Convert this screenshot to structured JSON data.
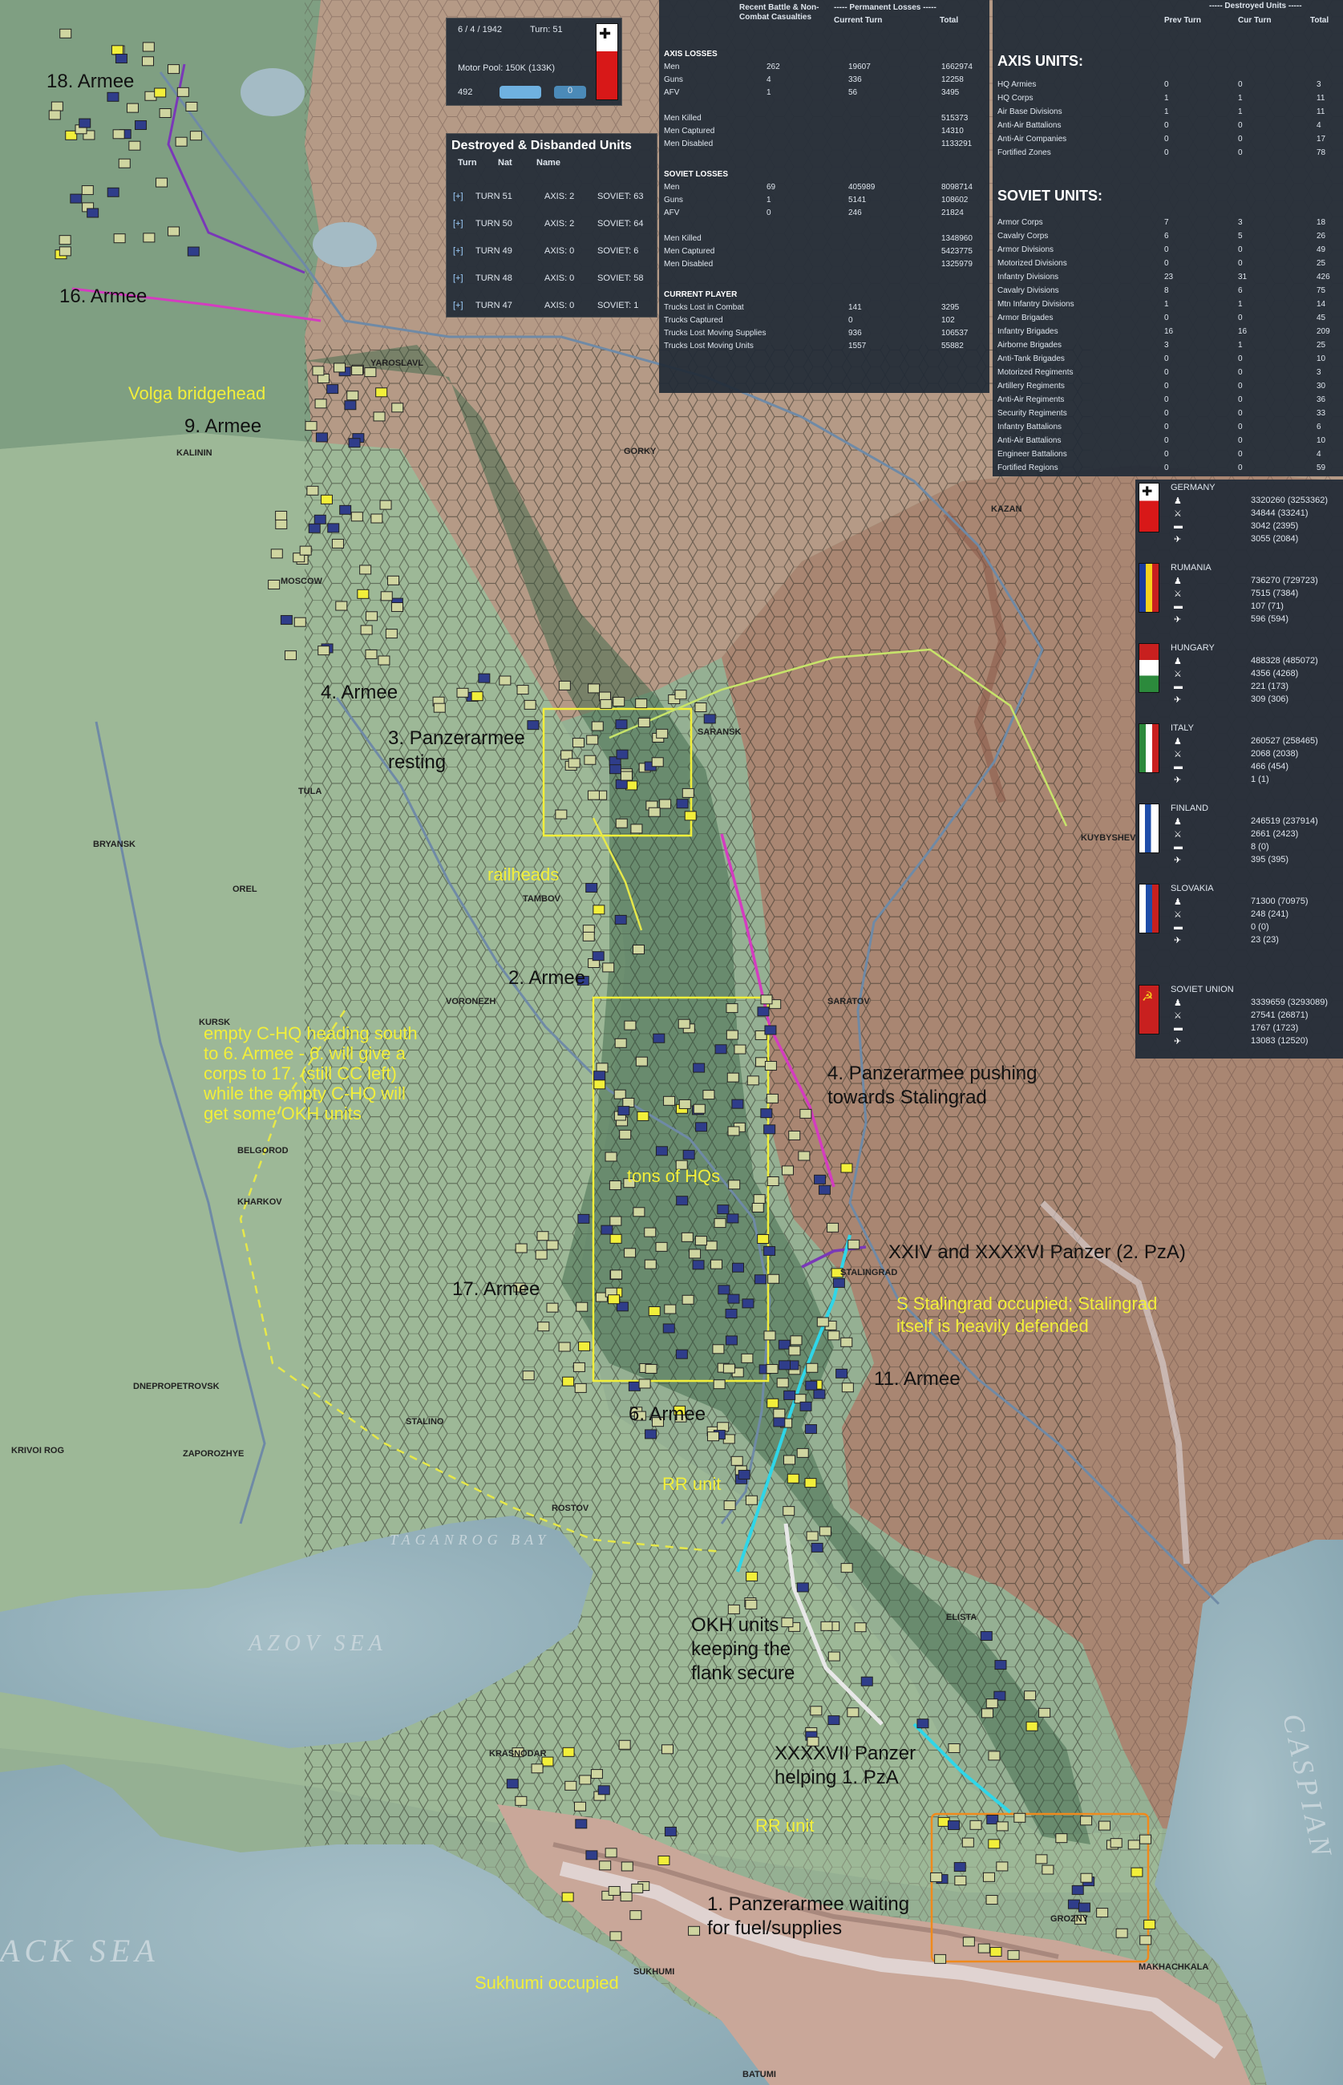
{
  "colors": {
    "axis_unit": "#cfd5a0",
    "soviet_unit": "#2f3d8a",
    "hq_yellow": "#f2ef3a",
    "arrow_magenta": "#d43cc0",
    "arrow_cyan": "#2fd6e8",
    "arrow_white": "#e8e8e8",
    "arrow_purple": "#7a38b8",
    "orange_box": "#f08a1c"
  },
  "turn_box": {
    "date": "6 / 4 / 1942",
    "turn": "Turn: 51",
    "motor_pool": "Motor Pool:  150K (133K)",
    "value_a": "492",
    "value_b": "0"
  },
  "destroyed_panel": {
    "title": "Destroyed & Disbanded Units",
    "headers": [
      "Turn",
      "Nat",
      "Name"
    ],
    "rows": [
      {
        "expand": "[+]",
        "turn": "TURN 51",
        "axis": "AXIS: 2",
        "soviet": "SOVIET: 63"
      },
      {
        "expand": "[+]",
        "turn": "TURN 50",
        "axis": "AXIS: 2",
        "soviet": "SOVIET: 64"
      },
      {
        "expand": "[+]",
        "turn": "TURN 49",
        "axis": "AXIS: 0",
        "soviet": "SOVIET: 6"
      },
      {
        "expand": "[+]",
        "turn": "TURN 48",
        "axis": "AXIS: 0",
        "soviet": "SOVIET: 58"
      },
      {
        "expand": "[+]",
        "turn": "TURN 47",
        "axis": "AXIS: 0",
        "soviet": "SOVIET: 1"
      }
    ]
  },
  "losses_panel": {
    "header_left": "Recent Battle & Non-Combat Casualties",
    "header_right": "----- Permanent Losses -----",
    "col_current": "Current Turn",
    "col_total": "Total",
    "sections": [
      {
        "title": "AXIS LOSSES",
        "rows": [
          [
            "Men",
            "262",
            "19607",
            "1662974"
          ],
          [
            "Guns",
            "4",
            "336",
            "12258"
          ],
          [
            "AFV",
            "1",
            "56",
            "3495"
          ],
          [
            "",
            "",
            "",
            ""
          ],
          [
            "Men Killed",
            "",
            "",
            "515373"
          ],
          [
            "Men Captured",
            "",
            "",
            "14310"
          ],
          [
            "Men Disabled",
            "",
            "",
            "1133291"
          ]
        ]
      },
      {
        "title": "SOVIET LOSSES",
        "rows": [
          [
            "Men",
            "69",
            "405989",
            "8098714"
          ],
          [
            "Guns",
            "1",
            "5141",
            "108602"
          ],
          [
            "AFV",
            "0",
            "246",
            "21824"
          ],
          [
            "",
            "",
            "",
            ""
          ],
          [
            "Men Killed",
            "",
            "",
            "1348960"
          ],
          [
            "Men Captured",
            "",
            "",
            "5423775"
          ],
          [
            "Men Disabled",
            "",
            "",
            "1325979"
          ]
        ]
      },
      {
        "title": "CURRENT PLAYER",
        "rows": [
          [
            "Trucks Lost in Combat",
            "",
            "141",
            "3295"
          ],
          [
            "Trucks Captured",
            "",
            "0",
            "102"
          ],
          [
            "Trucks Lost Moving Supplies",
            "",
            "936",
            "106537"
          ],
          [
            "Trucks Lost Moving Units",
            "",
            "1557",
            "55882"
          ]
        ]
      }
    ]
  },
  "units_panel": {
    "header": "----- Destroyed Units -----",
    "col_prev": "Prev Turn",
    "col_cur": "Cur Turn",
    "col_total": "Total",
    "axis_title": "AXIS UNITS:",
    "axis_rows": [
      [
        "HQ Armies",
        "0",
        "0",
        "3"
      ],
      [
        "HQ Corps",
        "1",
        "1",
        "11"
      ],
      [
        "Air Base Divisions",
        "1",
        "1",
        "11"
      ],
      [
        "Anti-Air Battalions",
        "0",
        "0",
        "4"
      ],
      [
        "Anti-Air Companies",
        "0",
        "0",
        "17"
      ],
      [
        "Fortified Zones",
        "0",
        "0",
        "78"
      ]
    ],
    "soviet_title": "SOVIET UNITS:",
    "soviet_rows": [
      [
        "Armor Corps",
        "7",
        "3",
        "18"
      ],
      [
        "Cavalry Corps",
        "6",
        "5",
        "26"
      ],
      [
        "Armor Divisions",
        "0",
        "0",
        "49"
      ],
      [
        "Motorized Divisions",
        "0",
        "0",
        "25"
      ],
      [
        "Infantry Divisions",
        "23",
        "31",
        "426"
      ],
      [
        "Cavalry Divisions",
        "8",
        "6",
        "75"
      ],
      [
        "Mtn Infantry Divisions",
        "1",
        "1",
        "14"
      ],
      [
        "Armor Brigades",
        "0",
        "0",
        "45"
      ],
      [
        "Infantry Brigades",
        "16",
        "16",
        "209"
      ],
      [
        "Airborne Brigades",
        "3",
        "1",
        "25"
      ],
      [
        "Anti-Tank Brigades",
        "0",
        "0",
        "10"
      ],
      [
        "Motorized Regiments",
        "0",
        "0",
        "3"
      ],
      [
        "Artillery Regiments",
        "0",
        "0",
        "30"
      ],
      [
        "Anti-Air Regiments",
        "0",
        "0",
        "36"
      ],
      [
        "Security Regiments",
        "0",
        "0",
        "33"
      ],
      [
        "Infantry Battalions",
        "0",
        "0",
        "6"
      ],
      [
        "Anti-Air Battalions",
        "0",
        "0",
        "10"
      ],
      [
        "Engineer Battalions",
        "0",
        "0",
        "4"
      ],
      [
        "Fortified Regions",
        "0",
        "0",
        "59"
      ]
    ]
  },
  "nations_panel": [
    {
      "name": "GERMANY",
      "values": [
        "3320260 (3253362)",
        "34844 (33241)",
        "3042 (2395)",
        "3055 (2084)"
      ],
      "flag": "germany"
    },
    {
      "name": "RUMANIA",
      "values": [
        "736270 (729723)",
        "7515 (7384)",
        "107 (71)",
        "596 (594)"
      ],
      "flag": "rumania"
    },
    {
      "name": "HUNGARY",
      "values": [
        "488328 (485072)",
        "4356 (4268)",
        "221 (173)",
        "309 (306)"
      ],
      "flag": "hungary"
    },
    {
      "name": "ITALY",
      "values": [
        "260527 (258465)",
        "2068 (2038)",
        "466 (454)",
        "1 (1)"
      ],
      "flag": "italy"
    },
    {
      "name": "FINLAND",
      "values": [
        "246519 (237914)",
        "2661 (2423)",
        "8 (0)",
        "395 (395)"
      ],
      "flag": "finland"
    },
    {
      "name": "SLOVAKIA",
      "values": [
        "71300 (70975)",
        "248 (241)",
        "0 (0)",
        "23 (23)"
      ],
      "flag": "slovakia"
    },
    {
      "name": "SOVIET UNION",
      "values": [
        "3339659 (3293089)",
        "27541 (26871)",
        "1767 (1723)",
        "13083 (12520)"
      ],
      "flag": "soviet"
    }
  ],
  "annotations": {
    "a18": "18. Armee",
    "a16": "16. Armee",
    "volga": "Volga bridgehead",
    "a9": "9. Armee",
    "a4": "4. Armee",
    "pz3_line1": "3. Panzerarmee",
    "pz3_line2": "resting",
    "railheads": "railheads",
    "a2": "2. Armee",
    "chq_line1": "empty C-HQ heading south",
    "chq_line2": "to 6. Armee - 6. will give a",
    "chq_line3": "corps to 17. (still CC left)",
    "chq_line4": "while the empty C-HQ will",
    "chq_line5": "get some OKH units",
    "pz4_line1": "4. Panzerarmee pushing",
    "pz4_line2": "towards Stalingrad",
    "tons": "tons of HQs",
    "xxiv": "XXIV and XXXXVI Panzer (2. PzA)",
    "a17": "17. Armee",
    "stal_line1": "S Stalingrad occupied; Stalingrad",
    "stal_line2": "itself is heavily defended",
    "a11": "11. Armee",
    "a6": "6. Armee",
    "rr1": "RR unit",
    "okh_line1": "OKH units",
    "okh_line2": "keeping the",
    "okh_line3": "flank secure",
    "xxxxvii_line1": "XXXXVII Panzer",
    "xxxxvii_line2": "helping 1. PzA",
    "rr2": "RR unit",
    "pz1_line1": "1. Panzerarmee waiting",
    "pz1_line2": "for fuel/supplies",
    "sukhumi": "Sukhumi occupied"
  },
  "places": {
    "yaroslavl": "YAROSLAVL",
    "gorky": "GORKY",
    "kazan": "KAZAN",
    "kalinin": "KALININ",
    "moscow": "MOSCOW",
    "tula": "TULA",
    "saransk": "SARANSK",
    "kuybyshev": "KUYBYSHEV",
    "bryansk": "BRYANSK",
    "orel": "OREL",
    "tambov": "TAMBOV",
    "voronezh": "VORONEZH",
    "kursk": "KURSK",
    "saratov": "SARATOV",
    "belgorod": "BELGOROD",
    "kharkov": "KHARKOV",
    "stalingrad": "STALINGRAD",
    "dnepropetrovsk": "DNEPROPETROVSK",
    "zaporozhye": "ZAPOROZHYE",
    "krivoi_rog": "KRIVOI ROG",
    "stalino": "STALINO",
    "rostov": "ROSTOV",
    "taganrog": "TAGANROG BAY",
    "azov": "AZOV SEA",
    "krasnodar": "KRASNODAR",
    "black": "ACK SEA",
    "caspian": "CASPIAN",
    "sukhumi": "SUKHUMI",
    "makhachkala": "MAKHACHKALA",
    "batumi": "BATUMI",
    "grozny": "GROZNY",
    "elista": "ELISTA"
  }
}
